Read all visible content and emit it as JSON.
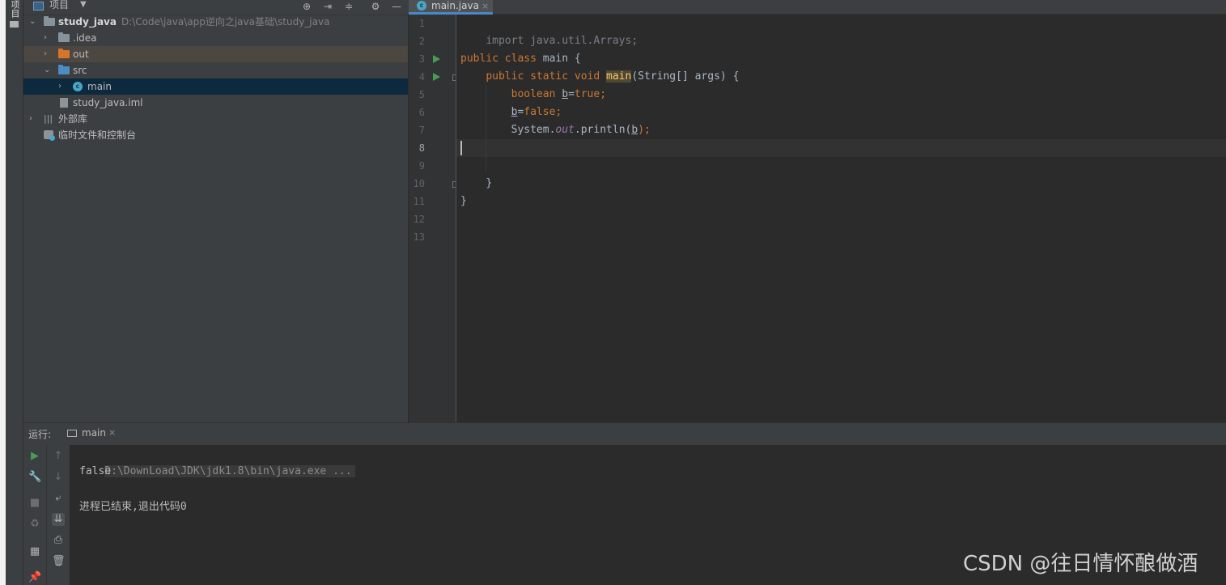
{
  "toolwindow_strip": {
    "label": "项目"
  },
  "project_panel": {
    "title": "项目",
    "toolbar_icons": [
      "target-icon",
      "collapse-all-icon",
      "expand-icon",
      "gear-icon",
      "minimize-icon"
    ],
    "tree": [
      {
        "name": "study_java",
        "path": "D:\\Code\\java\\app逆向之java基础\\study_java",
        "expanded": true
      },
      {
        "name": ".idea",
        "expanded": false
      },
      {
        "name": "out",
        "expanded": false
      },
      {
        "name": "src",
        "expanded": true
      },
      {
        "name": "main",
        "expanded": false,
        "selected": true
      },
      {
        "name": "study_java.iml"
      },
      {
        "name": "外部库",
        "expanded": false
      },
      {
        "name": "临时文件和控制台"
      }
    ]
  },
  "editor": {
    "tab": {
      "label": "main.java",
      "icon": "class-icon"
    },
    "line_numbers": [
      "1",
      "2",
      "3",
      "4",
      "5",
      "6",
      "7",
      "8",
      "9",
      "10",
      "11",
      "12",
      "13"
    ],
    "current_line": "8",
    "code": {
      "l1": "import java.util.Arrays;",
      "l3_kw": "public class ",
      "l3_rest": "main {",
      "l4_kw": "public static void ",
      "l4_meth": "main",
      "l4_rest": "(String[] args) {",
      "l5_kw": "boolean ",
      "l5_var": "b",
      "l5_op": "=",
      "l5_val": "true;",
      "l6_var": "b",
      "l6_op": "=",
      "l6_val": "false;",
      "l7_a": "System.",
      "l7_field": "out",
      "l7_b": ".println(",
      "l7_var": "b",
      "l7_c": ");",
      "l10": "}",
      "l11": "}"
    }
  },
  "run_panel": {
    "label": "运行:",
    "tab_label": "main",
    "console": {
      "command": "D:\\DownLoad\\JDK\\jdk1.8\\bin\\java.exe ...",
      "output": "false",
      "exit": "进程已结束,退出代码0"
    }
  },
  "watermark": "CSDN @往日情怀酿做酒",
  "colors": {
    "background": "#2b2b2b",
    "panel": "#3c3f41",
    "keyword": "#cc7832",
    "method": "#ffc66d",
    "field": "#9876aa",
    "selection": "#0d293e",
    "run_green": "#499c54"
  }
}
